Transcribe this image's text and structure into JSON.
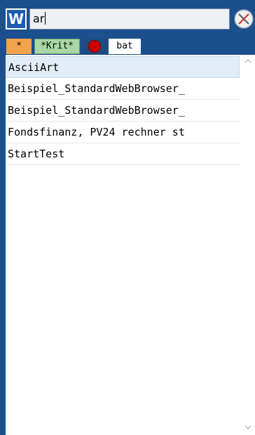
{
  "header": {
    "app_icon_letter": "W",
    "search": {
      "value": "ar"
    },
    "clear_icon": "clear-search-icon"
  },
  "filters": [
    {
      "label": "*",
      "color": "#f3a34c"
    },
    {
      "label": "*Krit*",
      "color": "#a8d8a5"
    },
    {
      "label": "",
      "icon": "red-record-dot-icon",
      "color": "#cc0000"
    },
    {
      "label": "bat",
      "color": "#ffffff"
    }
  ],
  "results": [
    {
      "label": "AsciiArt",
      "selected": true
    },
    {
      "label": "Beispiel_StandardWebBrowser_"
    },
    {
      "label": "Beispiel_StandardWebBrowser_"
    },
    {
      "label": "Fondsfinanz, PV24 rechner st"
    },
    {
      "label": "StartTest"
    }
  ],
  "scrollbar": {
    "up_icon": "chevron-up-icon",
    "down_icon": "chevron-down-icon"
  },
  "colors": {
    "frame": "#1b4f8e",
    "selection": "#e3edf8",
    "clear_icon_bg": "#f0f0f0",
    "clear_icon_stroke": "#d03030"
  }
}
